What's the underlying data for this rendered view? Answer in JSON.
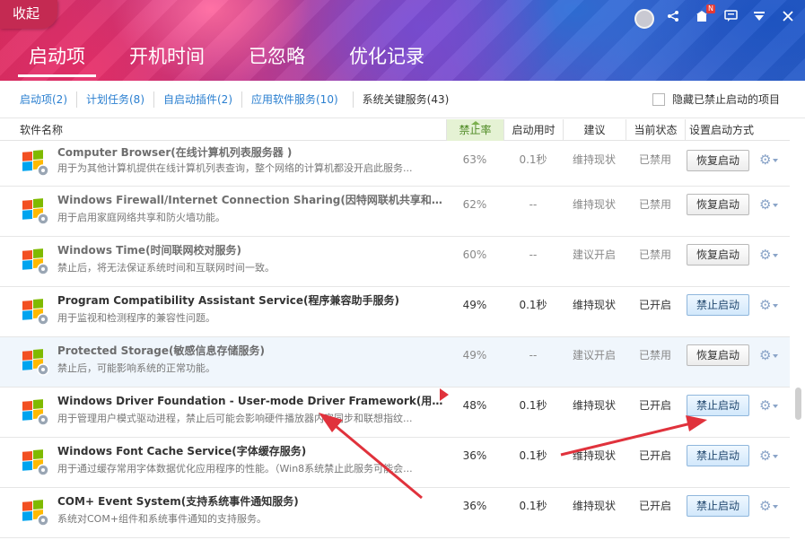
{
  "header": {
    "collapse_label": "收起",
    "tabs": [
      "启动项",
      "开机时间",
      "已忽略",
      "优化记录"
    ],
    "notification_badge": "N"
  },
  "filters": {
    "items": [
      "启动项(2)",
      "计划任务(8)",
      "自启动插件(2)",
      "应用软件服务(10)",
      "系统关键服务(43)"
    ],
    "hide_disabled_label": "隐藏已禁止启动的项目"
  },
  "table": {
    "columns": [
      "软件名称",
      "禁止率",
      "启动用时",
      "建议",
      "当前状态",
      "设置启动方式"
    ],
    "rows": [
      {
        "title": "Computer Browser(在线计算机列表服务器 )",
        "desc": "用于为其他计算机提供在线计算机列表查询，整个网络的计算机都没开启此服务...",
        "rate": "63%",
        "time": "0.1秒",
        "suggestion": "维持现状",
        "state": "已禁用",
        "action": "恢复启动"
      },
      {
        "title": "Windows Firewall/Internet Connection Sharing(因特网联机共享和防火墙...",
        "desc": "用于启用家庭网络共享和防火墙功能。",
        "rate": "62%",
        "time": "--",
        "suggestion": "维持现状",
        "state": "已禁用",
        "action": "恢复启动"
      },
      {
        "title": "Windows Time(时间联网校对服务)",
        "desc": "禁止后，将无法保证系统时间和互联网时间一致。",
        "rate": "60%",
        "time": "--",
        "suggestion": "建议开启",
        "state": "已禁用",
        "action": "恢复启动"
      },
      {
        "title": "Program Compatibility Assistant Service(程序兼容助手服务)",
        "desc": "用于监视和检测程序的兼容性问题。",
        "rate": "49%",
        "time": "0.1秒",
        "suggestion": "维持现状",
        "state": "已开启",
        "action": "禁止启动"
      },
      {
        "title": "Protected Storage(敏感信息存储服务)",
        "desc": "禁止后，可能影响系统的正常功能。",
        "rate": "49%",
        "time": "--",
        "suggestion": "建议开启",
        "state": "已禁用",
        "action": "恢复启动"
      },
      {
        "title": "Windows Driver Foundation - User-mode Driver Framework(用户模式...",
        "desc": "用于管理用户模式驱动进程，禁止后可能会影响硬件播放器内容同步和联想指纹...",
        "rate": "48%",
        "time": "0.1秒",
        "suggestion": "维持现状",
        "state": "已开启",
        "action": "禁止启动"
      },
      {
        "title": "Windows Font Cache Service(字体缓存服务)",
        "desc": "用于通过缓存常用字体数据优化应用程序的性能。（Win8系统禁止此服务可能会...",
        "rate": "36%",
        "time": "0.1秒",
        "suggestion": "维持现状",
        "state": "已开启",
        "action": "禁止启动"
      },
      {
        "title": "COM+ Event System(支持系统事件通知服务)",
        "desc": "系统对COM+组件和系统事件通知的支持服务。",
        "rate": "36%",
        "time": "0.1秒",
        "suggestion": "维持现状",
        "state": "已开启",
        "action": "禁止启动"
      }
    ]
  },
  "colors": {
    "accent_link": "#2a7fd0",
    "sort_column_bg": "#e5f2d4",
    "annotation_arrow": "#e0323c"
  }
}
